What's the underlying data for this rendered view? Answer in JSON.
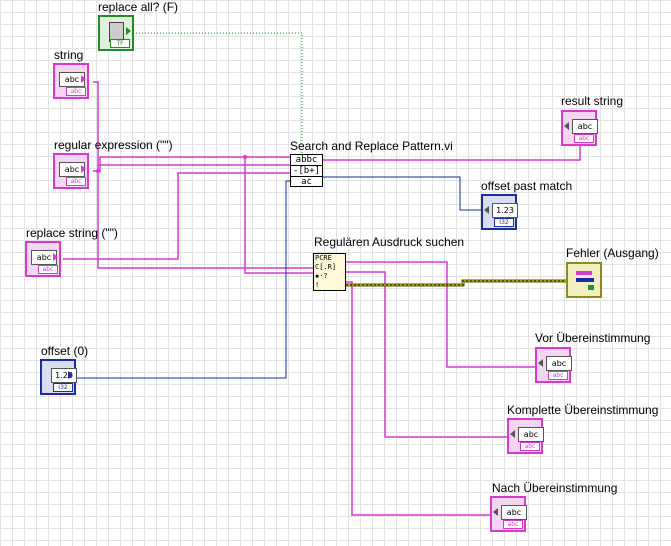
{
  "labels": {
    "replace_all": "replace all? (F)",
    "string": "string",
    "regex": "regular expression (\"\")",
    "replace_string": "replace string (\"\")",
    "offset": "offset (0)",
    "search_replace_vi": "Search and Replace Pattern.vi",
    "result_string": "result string",
    "offset_past_match": "offset past match",
    "regex_search": "Regulären Ausdruck suchen",
    "error_out": "Fehler (Ausgang)",
    "before_match": "Vor Übereinstimmung",
    "whole_match": "Komplette Übereinstimmung",
    "after_match": "Nach Übereinstimmung"
  },
  "terminal_text": {
    "abc": "abc",
    "num": "1.23",
    "tf": "TF"
  },
  "node_text": {
    "sr_line1": "abbc",
    "sr_line2": "-[b+]",
    "sr_line3": "ac",
    "pcre": "PCRE",
    "pcre_sub": "C[.R]"
  },
  "colors": {
    "string_wire": "#d83ad0",
    "numeric_wire": "#1a2d9c",
    "boolean_wire": "#228b22",
    "error_wire": "#8a8a1e",
    "grid": "#e3e3e3"
  }
}
